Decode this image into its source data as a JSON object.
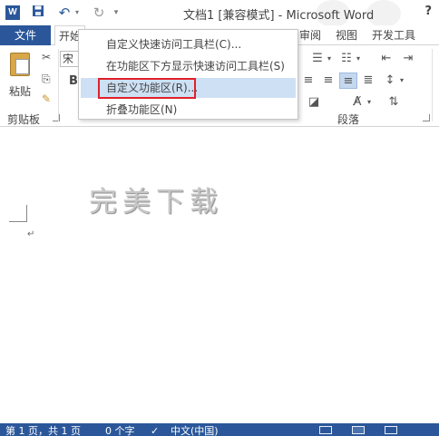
{
  "title_bar": {
    "app_icon_label": "W",
    "save_icon": "save-icon",
    "undo_icon": "undo-icon",
    "redo_icon": "redo-icon",
    "title": "文档1 [兼容模式] - Microsoft Word",
    "help_label": "?"
  },
  "tabs": {
    "file": "文件",
    "home": "开始",
    "review": "审阅",
    "view": "视图",
    "developer": "开发工具"
  },
  "ribbon": {
    "paste_label": "粘贴",
    "font_name": "宋",
    "bold_label": "B",
    "clipboard_group": "剪贴板",
    "paragraph_group": "段落"
  },
  "context_menu": {
    "items": [
      "自定义快速访问工具栏(C)...",
      "在功能区下方显示快速访问工具栏(S)",
      "自定义功能区(R)...",
      "折叠功能区(N)"
    ]
  },
  "document": {
    "watermark": "完美下载",
    "paragraph_mark": "↵"
  },
  "status_bar": {
    "page": "第 1 页，共 1 页",
    "words": "0 个字",
    "language": "中文(中国)"
  },
  "colors": {
    "accent": "#2b579a",
    "menu_hover": "#cde0f4",
    "highlight_box": "#e0202a"
  }
}
